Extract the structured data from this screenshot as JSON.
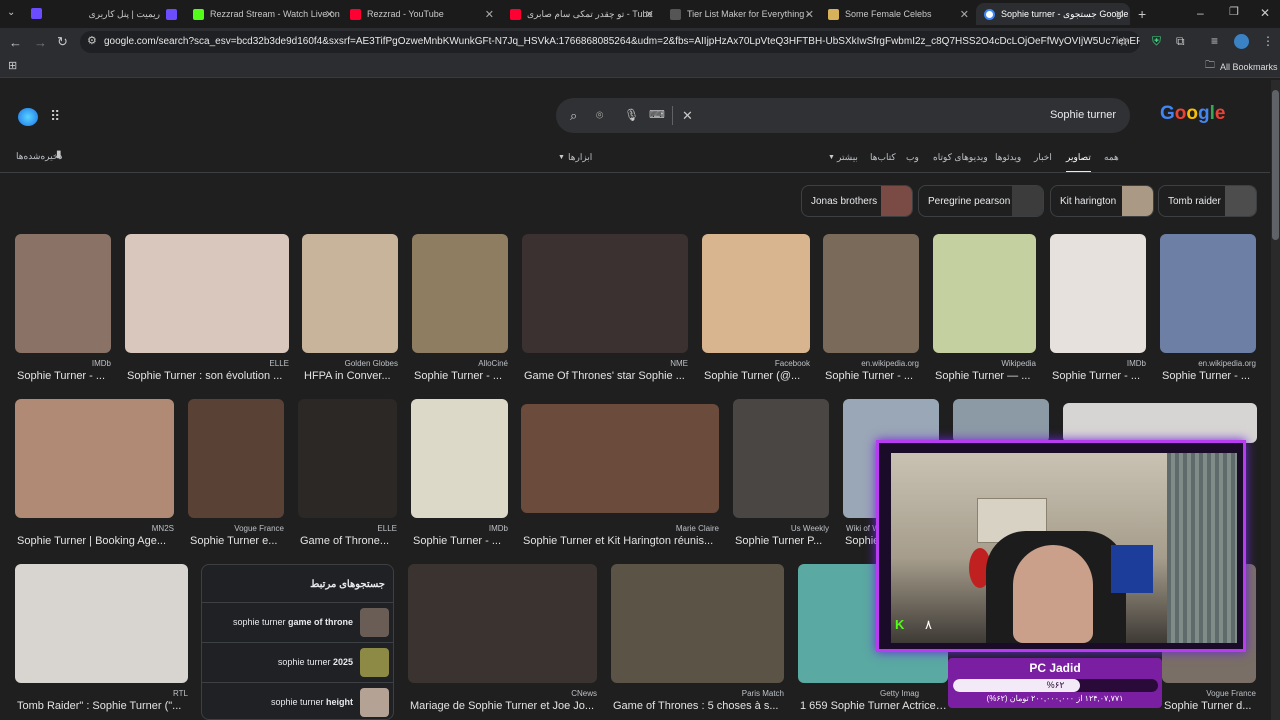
{
  "tabs": [
    {
      "label": "ریمیت | پنل کاربری",
      "color": "#6b4cff"
    },
    {
      "label": "Rezzrad Stream - Watch Live on",
      "color": "#53fc18"
    },
    {
      "label": "Rezzrad - YouTube",
      "color": "#ff0033"
    },
    {
      "label": "تو چقدر تمکی سام صابری - Tube",
      "color": "#ff0033"
    },
    {
      "label": "Tier List Maker for Everything -",
      "color": "#2b2b2b"
    },
    {
      "label": "Some Female Celebs",
      "color": "#d8b25a"
    },
    {
      "label": "Sophie turner - جستجوی Google",
      "color": "#4285f4"
    }
  ],
  "address": {
    "url": "google.com/search?sca_esv=bcd32b3de9d160f4&sxsrf=AE3TifPgOzweMnbKWunkGFt-N7Jq_HSVkA:1766868085264&udm=2&fbs=AIIjpHzAx70LpVteQ3HFTBH-UbSXkIwSfrgFwbmI2z_c8Q7HSS2O4cDcLOjOeFfWyOVIjW5Uc7ienEPJlsmVizCHsV...",
    "bookmarks_label": "All Bookmarks"
  },
  "search": {
    "query": "Sophie turner",
    "logo": "Google",
    "saved_label": "ذخیره‌شده‌ها",
    "tools_label": "ابزارها"
  },
  "nav": [
    "همه",
    "تصاویر",
    "اخبار",
    "ویدئوها",
    "ویدیوهای کوتاه",
    "وب",
    "کتاب‌ها",
    "بیشتر"
  ],
  "chips": [
    {
      "label": "Jonas brothers"
    },
    {
      "label": "Peregrine pearson"
    },
    {
      "label": "Kit harington"
    },
    {
      "label": "Tomb raider"
    }
  ],
  "row1": [
    {
      "source": "IMDb",
      "caption": "Sophie Turner - ...",
      "color": "#8a7366"
    },
    {
      "source": "ELLE",
      "caption": "Sophie Turner : son évolution ...",
      "color": "#d9c7bd"
    },
    {
      "source": "Golden Globes",
      "caption": "HFPA in Conver...",
      "color": "#c8b49a"
    },
    {
      "source": "AlloCiné",
      "caption": "Sophie Turner - ...",
      "color": "#8f7d62"
    },
    {
      "source": "NME",
      "caption": "Game Of Thrones' star Sophie ...",
      "color": "#3a3130"
    },
    {
      "source": "Facebook",
      "caption": "Sophie Turner (@...",
      "color": "#d8b48f"
    },
    {
      "source": "en.wikipedia.org",
      "caption": "Sophie Turner - ...",
      "color": "#7a6a5a"
    },
    {
      "source": "Wikipedia",
      "caption": "Sophie Turner — ...",
      "color": "#c4d0a0"
    },
    {
      "source": "IMDb",
      "caption": "Sophie Turner - ...",
      "color": "#e6e1dc"
    },
    {
      "source": "en.wikipedia.org",
      "caption": "Sophie Turner - ...",
      "color": "#6e7fa5"
    }
  ],
  "row2": [
    {
      "source": "MN2S",
      "caption": "Sophie Turner | Booking Age...",
      "color": "#b08a74"
    },
    {
      "source": "Vogue France",
      "caption": "Sophie Turner e...",
      "color": "#5a4136"
    },
    {
      "source": "ELLE",
      "caption": "Game of Throne...",
      "color": "#2b2826"
    },
    {
      "source": "IMDb",
      "caption": "Sophie Turner - ...",
      "color": "#dcd9c8"
    },
    {
      "source": "Marie Claire",
      "caption": "Sophie Turner et Kit Harington réunis...",
      "color": "#6a4b3c"
    },
    {
      "source": "Us Weekly",
      "caption": "Sophie Turner P...",
      "color": "#4a4644"
    },
    {
      "source": "Wiki of W",
      "caption": "Sophie",
      "color": "#9aa7b6"
    }
  ],
  "row3": [
    {
      "source": "RTL",
      "caption": "Tomb Raider\" : Sophie Turner (\"...",
      "color": "#d8d4d0"
    },
    {
      "source": "CNews",
      "caption": "Mariage de Sophie Turner et Joe Jo...",
      "color": "#3b3330"
    },
    {
      "source": "Paris Match",
      "caption": "Game of Thrones : 5 choses à s...",
      "color": "#5b5346"
    },
    {
      "source": "Getty Imag",
      "caption": "1 659 Sophie Turner Actrice Ph...",
      "color": "#5aa9a2"
    },
    {
      "source": "Vogue France",
      "caption": "Sophie Turner d...",
      "color": "#7a6f66"
    }
  ],
  "related": {
    "title": "جستجوهای مرتبط",
    "items": [
      {
        "prefix": "sophie turner ",
        "bold": "game of throne",
        "color": "#6a5d55"
      },
      {
        "prefix": "sophie turner ",
        "bold": "2025",
        "color": "#8c8a44"
      },
      {
        "prefix": "sophie turner ",
        "bold": "height",
        "color": "#b4a394"
      }
    ]
  },
  "stream": {
    "donation_title": "PC Jadid",
    "progress_label": "%۶۲",
    "progress": 0.62,
    "donation_sub": "۱۲۴,۰۷,۷۷۱ از ۲۰۰,۰۰۰,۰۰۰ تومان (۶۲%)",
    "counter": "۸",
    "kick_letter": "K"
  }
}
